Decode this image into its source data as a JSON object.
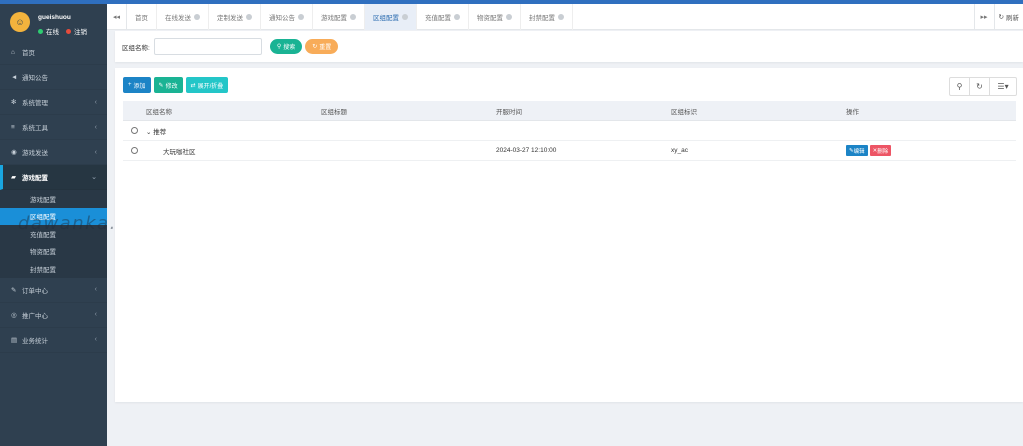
{
  "colors": {
    "sidebar_bg": "#2f4050",
    "accent": "#1a8fd8",
    "tab_active": "#2b6cb0",
    "green": "#1ab394",
    "orange": "#f8ac59",
    "danger": "#ed5565"
  },
  "sidebar": {
    "username": "gueishuou",
    "status_online": "在线",
    "status_logout": "注销",
    "items": [
      {
        "label": "首页",
        "icon": "home-icon"
      },
      {
        "label": "通知公告",
        "icon": "bullhorn-icon"
      },
      {
        "label": "系统管理",
        "icon": "gear-icon"
      },
      {
        "label": "系统工具",
        "icon": "bars-icon"
      },
      {
        "label": "游戏发送",
        "icon": "gamepad-icon"
      },
      {
        "label": "游戏配置",
        "icon": "car-icon"
      },
      {
        "label": "订单中心",
        "icon": "pencil-icon"
      },
      {
        "label": "推广中心",
        "icon": "eye-icon"
      },
      {
        "label": "业务统计",
        "icon": "chart-icon"
      }
    ],
    "submenu": [
      {
        "label": "游戏配置"
      },
      {
        "label": "区组配置"
      },
      {
        "label": "充值配置"
      },
      {
        "label": "物资配置"
      },
      {
        "label": "封禁配置"
      }
    ]
  },
  "tabs": [
    {
      "label": "首页"
    },
    {
      "label": "在线发送"
    },
    {
      "label": "定制发送"
    },
    {
      "label": "通知公告"
    },
    {
      "label": "游戏配置"
    },
    {
      "label": "区组配置"
    },
    {
      "label": "充值配置"
    },
    {
      "label": "物资配置"
    },
    {
      "label": "封禁配置"
    }
  ],
  "header": {
    "refresh_label": "刷新"
  },
  "search": {
    "label": "区组名称:",
    "value": "",
    "search_btn": "搜索",
    "reset_btn": "重置"
  },
  "toolbar": {
    "add": "添加",
    "edit": "修改",
    "expand": "展开/折叠"
  },
  "table": {
    "columns": [
      "区组名称",
      "区组标题",
      "开服时间",
      "区组标识",
      "操作"
    ],
    "rows": [
      {
        "name": "推荐",
        "title": "",
        "open_time": "",
        "tag": "",
        "expandable": true
      },
      {
        "name": "大玩咖社区",
        "title": "",
        "open_time": "2024-03-27 12:10:00",
        "tag": "xy_ac",
        "edit": "编辑",
        "delete": "删除"
      }
    ]
  },
  "watermark": "dawanka.cn"
}
